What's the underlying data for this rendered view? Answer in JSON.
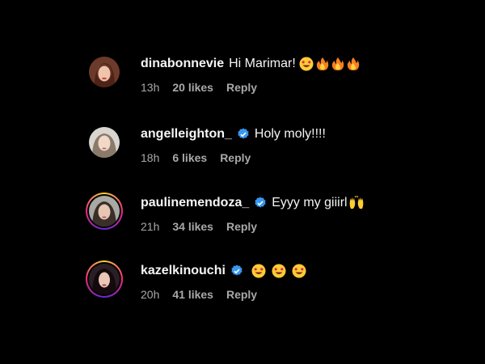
{
  "colors": {
    "background": "#000000",
    "text": "#f5f5f5",
    "meta": "#a8a8a8",
    "verified": "#3897f0"
  },
  "comments": [
    {
      "username": "dinabonnevie",
      "verified": false,
      "story_ring": false,
      "text": "Hi Marimar!",
      "emojis": [
        "heart-eyes-emoji",
        "fire-emoji",
        "fire-emoji",
        "fire-emoji"
      ],
      "time": "13h",
      "likes": "20 likes",
      "reply": "Reply"
    },
    {
      "username": "angelleighton_",
      "verified": true,
      "story_ring": false,
      "text": "Holy moly!!!!",
      "emojis": [],
      "time": "18h",
      "likes": "6 likes",
      "reply": "Reply"
    },
    {
      "username": "paulinemendoza_",
      "verified": true,
      "story_ring": true,
      "text": "Eyyy my giiirl",
      "emojis": [
        "raising-hands-emoji"
      ],
      "time": "21h",
      "likes": "34 likes",
      "reply": "Reply"
    },
    {
      "username": "kazelkinouchi",
      "verified": true,
      "story_ring": true,
      "text": "",
      "emojis": [
        "heart-eyes-emoji",
        "heart-eyes-emoji",
        "heart-eyes-emoji"
      ],
      "time": "20h",
      "likes": "41 likes",
      "reply": "Reply"
    }
  ]
}
